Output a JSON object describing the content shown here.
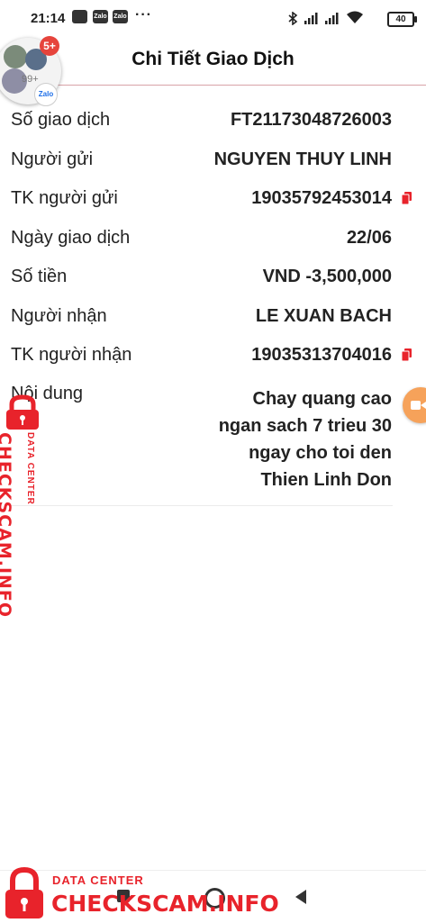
{
  "status_bar": {
    "time": "21:14",
    "app_icons": [
      "Zalo",
      "Zalo"
    ],
    "more": "···",
    "battery": "40"
  },
  "header": {
    "title": "Chi Tiết Giao Dịch"
  },
  "chat_bubble": {
    "badge": "5+",
    "more_count": "99+",
    "app": "Zalo"
  },
  "details": [
    {
      "label": "Số giao dịch",
      "value": "FT21173048726003",
      "copyable": false
    },
    {
      "label": "Người gửi",
      "value": "NGUYEN THUY LINH",
      "copyable": false
    },
    {
      "label": "TK người gửi",
      "value": "19035792453014",
      "copyable": true
    },
    {
      "label": "Ngày giao dịch",
      "value": "22/06",
      "copyable": false
    },
    {
      "label": "Số tiền",
      "value": "VND -3,500,000",
      "copyable": false
    },
    {
      "label": "Người nhận",
      "value": "LE XUAN BACH",
      "copyable": false
    },
    {
      "label": "TK người nhận",
      "value": "19035313704016",
      "copyable": true
    }
  ],
  "content": {
    "label": "Nội dung",
    "lines": [
      "Chay quang cao",
      "ngan sach 7 trieu 30",
      "ngay cho toi den",
      "Thien Linh Don"
    ]
  },
  "watermark": {
    "small": "DATA CENTER",
    "big": "CHECKSCAM.INFO"
  },
  "colors": {
    "accent_red": "#e8232b",
    "header_line": "#d9a3a8"
  }
}
